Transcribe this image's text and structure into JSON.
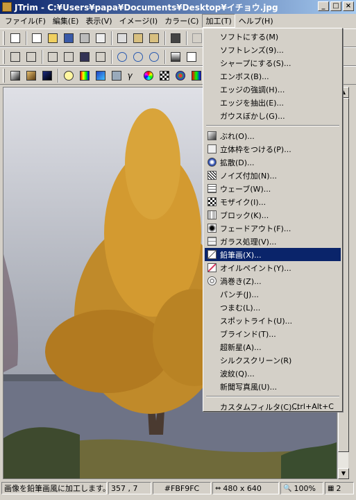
{
  "window": {
    "title": "JTrim - C:¥Users¥papa¥Documents¥Desktop¥イチョウ.jpg",
    "buttons": [
      "_",
      "□",
      "×"
    ]
  },
  "menubar": {
    "items": [
      "ファイル(F)",
      "編集(E)",
      "表示(V)",
      "イメージ(I)",
      "カラー(C)",
      "加工(T)",
      "ヘルプ(H)"
    ],
    "active_index": 5
  },
  "dropdown": {
    "group1": [
      "ソフトにする(M)",
      "ソフトレンズ(9)...",
      "シャープにする(S)...",
      "エンボス(B)...",
      "エッジの強調(H)...",
      "エッジを抽出(E)...",
      "ガウスぼかし(G)..."
    ],
    "group2": [
      {
        "label": "ぶれ(O)...",
        "icon": "blur-icon"
      },
      {
        "label": "立体枠をつける(P)...",
        "icon": "frame-icon"
      },
      {
        "label": "拡散(D)...",
        "icon": "diffuse-icon"
      },
      {
        "label": "ノイズ付加(N)...",
        "icon": "noise-icon"
      },
      {
        "label": "ウェーブ(W)...",
        "icon": "wave-icon"
      },
      {
        "label": "モザイク(I)...",
        "icon": "mosaic-icon"
      },
      {
        "label": "ブロック(K)...",
        "icon": "block-icon"
      },
      {
        "label": "フェードアウト(F)...",
        "icon": "fadeout-icon"
      },
      {
        "label": "ガラス処理(V)...",
        "icon": "glass-icon"
      },
      {
        "label": "鉛筆画(X)...",
        "icon": "pencil-icon"
      },
      {
        "label": "オイルペイント(Y)...",
        "icon": "oilpaint-icon"
      },
      {
        "label": "渦巻き(Z)...",
        "icon": "swirl-icon"
      },
      {
        "label": "パンチ(J)...",
        "icon": ""
      },
      {
        "label": "つまむ(L)...",
        "icon": ""
      },
      {
        "label": "スポットライト(U)...",
        "icon": ""
      },
      {
        "label": "ブラインド(T)...",
        "icon": ""
      },
      {
        "label": "超新星(A)...",
        "icon": ""
      },
      {
        "label": "シルクスクリーン(R)",
        "icon": ""
      },
      {
        "label": "波紋(Q)...",
        "icon": ""
      },
      {
        "label": "新聞写真風(U)...",
        "icon": ""
      }
    ],
    "highlight_index": 9,
    "custom": {
      "label": "カスタムフィルタ(C)...",
      "shortcut": "Ctrl+Alt+C"
    }
  },
  "statusbar": {
    "message": "画像を鉛筆画風に加工します。",
    "coords": "357 , 7",
    "color": "#FBF9FC",
    "size": "480 x 640",
    "zoom": "100%",
    "pages": "2"
  },
  "colors": {
    "title_gradient_start": "#0a246a",
    "title_gradient_end": "#a6caf0",
    "menu_highlight": "#0a246a",
    "chrome": "#d4d0c8"
  }
}
